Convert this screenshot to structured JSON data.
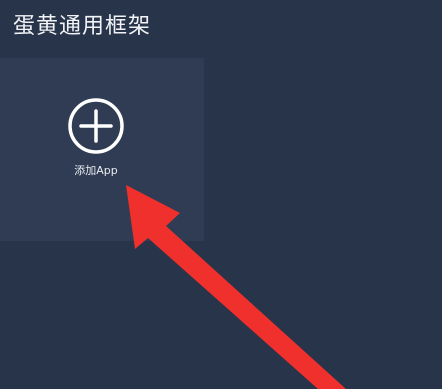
{
  "app": {
    "title": "蛋黄通用框架"
  },
  "add_tile": {
    "label": "添加App",
    "icon": "plus-circle-icon"
  },
  "annotation": {
    "icon": "red-arrow-icon",
    "color": "#f0302c"
  },
  "colors": {
    "background": "#28344a",
    "tile": "#2f3c53",
    "text": "#f2f4f7"
  }
}
